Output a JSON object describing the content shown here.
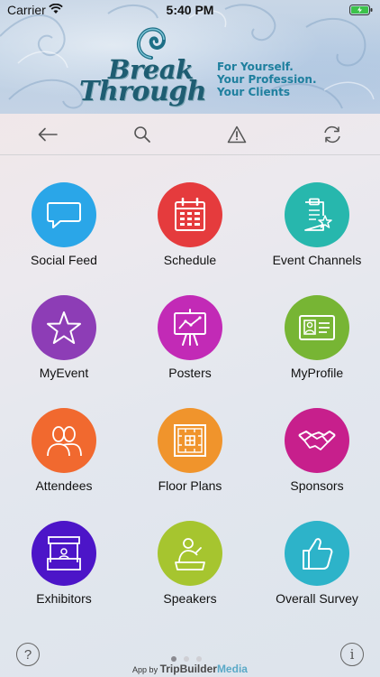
{
  "status_bar": {
    "carrier": "Carrier",
    "time": "5:40 PM"
  },
  "banner": {
    "logo_line1": "Break",
    "logo_line2": "Through",
    "tagline": [
      "For Yourself.",
      "Your Profession.",
      "Your Clients"
    ]
  },
  "toolbar": {
    "back": "back-arrow-icon",
    "search": "search-icon",
    "alert": "warning-icon",
    "refresh": "refresh-icon"
  },
  "tiles": [
    {
      "label": "Social Feed",
      "color": "#2aa6e8",
      "icon": "speech-bubble-icon"
    },
    {
      "label": "Schedule",
      "color": "#e53b3d",
      "icon": "calendar-icon"
    },
    {
      "label": "Event Channels",
      "color": "#27b7ad",
      "icon": "clipboard-star-icon"
    },
    {
      "label": "MyEvent",
      "color": "#8d3db6",
      "icon": "star-icon"
    },
    {
      "label": "Posters",
      "color": "#c22ab6",
      "icon": "easel-chart-icon"
    },
    {
      "label": "MyProfile",
      "color": "#77b534",
      "icon": "id-card-icon"
    },
    {
      "label": "Attendees",
      "color": "#f1692f",
      "icon": "people-icon"
    },
    {
      "label": "Floor Plans",
      "color": "#f0942c",
      "icon": "floor-plan-icon"
    },
    {
      "label": "Sponsors",
      "color": "#c71f8c",
      "icon": "handshake-icon"
    },
    {
      "label": "Exhibitors",
      "color": "#4c15c8",
      "icon": "booth-icon"
    },
    {
      "label": "Speakers",
      "color": "#a6c52f",
      "icon": "speaker-podium-icon"
    },
    {
      "label": "Overall Survey",
      "color": "#2db3c9",
      "icon": "thumbs-up-icon"
    }
  ],
  "footer": {
    "help": "?",
    "info": "i",
    "credit_prefix": "App by",
    "credit_brand_a": "TripBuilder",
    "credit_brand_b": "Media",
    "page_dots": 3,
    "active_page": 1
  }
}
